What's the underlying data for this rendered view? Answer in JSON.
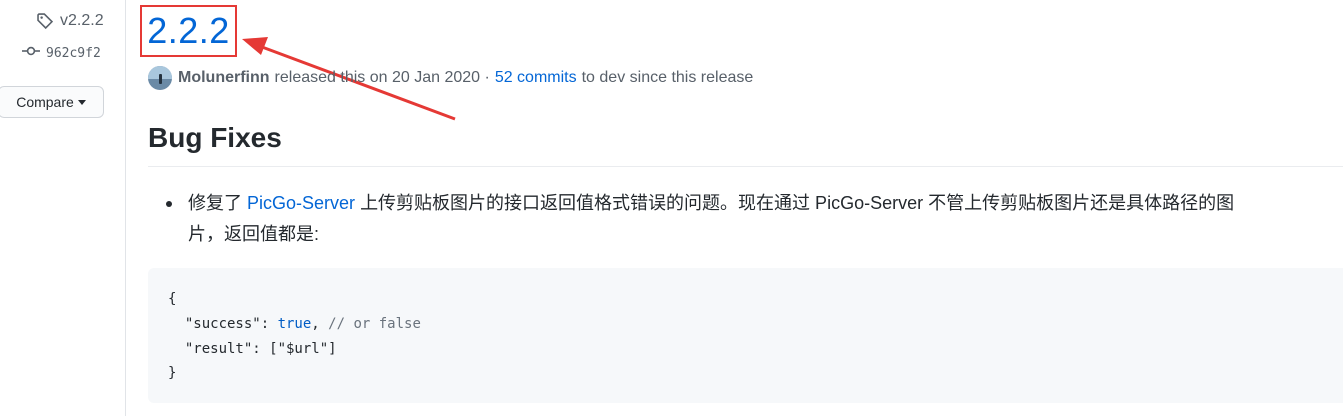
{
  "sidebar": {
    "tag": "v2.2.2",
    "commit": "962c9f2",
    "compare_label": "Compare"
  },
  "release": {
    "title": "2.2.2",
    "author": "Molunerfinn",
    "released_text": "released this on 20 Jan 2020 ·",
    "commits_link": "52 commits",
    "since_text": "to dev since this release"
  },
  "body": {
    "heading": "Bug Fixes",
    "bullet": {
      "prefix": "修复了",
      "link": "PicGo-Server",
      "line1_rest": "上传剪贴板图片的接口返回值格式错误的问题。现在通过 PicGo-Server 不管上传剪贴板图片还是具体路径的图",
      "line2": "片，返回值都是:"
    },
    "code": {
      "line1": "{",
      "line2_key": "  \"success\": ",
      "line2_value": "true",
      "line2_comma": ",",
      "line2_comment": " // or false",
      "line3": "  \"result\": [\"$url\"]",
      "line4": "}"
    }
  },
  "colors": {
    "link": "#0366d6",
    "annotation": "#e53935"
  }
}
